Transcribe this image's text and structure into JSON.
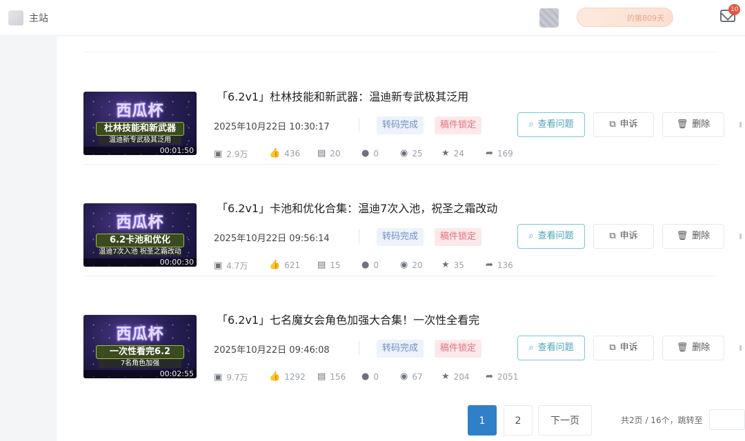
{
  "header": {
    "site_name": "主站",
    "days_text": "的第809天",
    "mail_badge": "10"
  },
  "videos": [
    {
      "title": "「6.2v1」杜林技能和新武器：温迪新专武极其泛用",
      "date": "2025年10月22日 10:30:17",
      "thumb": {
        "brand": "西瓜杯",
        "caption1": "杜林技能和新武器",
        "caption2": "温迪新专武极其泛用",
        "duration": "00:01:50"
      },
      "tag_transcode": "转码完成",
      "tag_lock": "稿件锁定",
      "stats": {
        "views": "2.9万",
        "likes": "436",
        "danmaku": "20",
        "comments": "0",
        "coins": "25",
        "favorites": "24",
        "shares": "169"
      }
    },
    {
      "title": "「6.2v1」卡池和优化合集：温迪7次入池，祝圣之霜改动",
      "date": "2025年10月22日 09:56:14",
      "thumb": {
        "brand": "西瓜杯",
        "caption1": "6.2卡池和优化",
        "caption2": "温迪7次入池 祝圣之霜改动",
        "duration": "00:00:30"
      },
      "tag_transcode": "转码完成",
      "tag_lock": "稿件锁定",
      "stats": {
        "views": "4.7万",
        "likes": "621",
        "danmaku": "15",
        "comments": "0",
        "coins": "20",
        "favorites": "35",
        "shares": "136"
      }
    },
    {
      "title": "「6.2v1」七名魔女会角色加强大合集！一次性全看完",
      "date": "2025年10月22日 09:46:08",
      "thumb": {
        "brand": "西瓜杯",
        "caption1": "一次性看完6.2",
        "caption2": "7名角色加强",
        "duration": "00:02:55"
      },
      "tag_transcode": "转码完成",
      "tag_lock": "稿件锁定",
      "stats": {
        "views": "9.7万",
        "likes": "1292",
        "danmaku": "156",
        "comments": "0",
        "coins": "67",
        "favorites": "204",
        "shares": "2051"
      }
    }
  ],
  "actions": {
    "view_issue": "查看问题",
    "appeal": "申诉",
    "delete": "删除"
  },
  "pagination": {
    "pages": [
      "1",
      "2"
    ],
    "next": "下一页",
    "info": "共2页 / 16个，跳转至"
  },
  "icons": {
    "views": "play-icon",
    "likes": "thumb-up-icon",
    "danmaku": "danmaku-icon",
    "comments": "comment-icon",
    "coins": "coin-icon",
    "favorites": "star-icon",
    "shares": "share-icon"
  },
  "colors": {
    "primary": "#2f80c8",
    "issue_button": "#4aa6b5",
    "tag_transcode_bg": "#edf2fb",
    "tag_lock_bg": "#fde8ea",
    "badge": "#e8533f"
  }
}
